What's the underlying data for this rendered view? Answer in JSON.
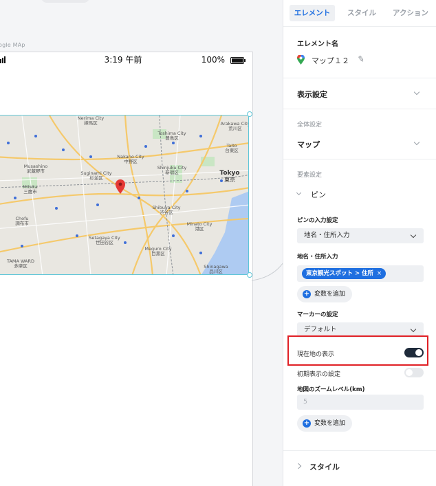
{
  "canvas": {
    "frame_label": "ogle MAp",
    "status_bar": {
      "time": "3:19 午前",
      "battery_text": "100%"
    },
    "map_labels": [
      {
        "text": "Nerima City"
      },
      {
        "text": "練馬区"
      },
      {
        "text": "Toshima City"
      },
      {
        "text": "豊島区"
      },
      {
        "text": "Arakawa City"
      },
      {
        "text": "荒川区"
      },
      {
        "text": "Nakano City"
      },
      {
        "text": "中野区"
      },
      {
        "text": "Suginami City"
      },
      {
        "text": "杉並区"
      },
      {
        "text": "Shinjuku City"
      },
      {
        "text": "新宿区"
      },
      {
        "text": "Tokyo"
      },
      {
        "text": "東京"
      },
      {
        "text": "Shibuya City"
      },
      {
        "text": "渋谷区"
      },
      {
        "text": "Minato City"
      },
      {
        "text": "港区"
      },
      {
        "text": "Setagaya City"
      },
      {
        "text": "世田谷区"
      },
      {
        "text": "Meguro City"
      },
      {
        "text": "目黒区"
      },
      {
        "text": "Shinagawa"
      },
      {
        "text": "品川区"
      },
      {
        "text": "Mitaka"
      },
      {
        "text": "三鷹市"
      },
      {
        "text": "Chofu"
      },
      {
        "text": "調布市"
      },
      {
        "text": "Musashino"
      },
      {
        "text": "武蔵野市"
      },
      {
        "text": "Taito"
      },
      {
        "text": "台東区"
      },
      {
        "text": "TAMA WARD"
      },
      {
        "text": "多摩区"
      }
    ]
  },
  "panel": {
    "tabs": [
      {
        "label": "エレメント",
        "active": true
      },
      {
        "label": "スタイル",
        "active": false
      },
      {
        "label": "アクション",
        "active": false
      }
    ],
    "element_name_heading": "エレメント名",
    "element_name": "マップ１２",
    "display_settings": "表示設定",
    "global_settings_label": "全体設定",
    "global_settings_value": "マップ",
    "element_settings_label": "要素設定",
    "pin_section": "ピン",
    "pin_input_label": "ピンの入力設定",
    "pin_input_value": "地名・住所入力",
    "address_input_label": "地名・住所入力",
    "address_chip": "東京観光スポット > 住所",
    "add_variable_label": "変数を追加",
    "marker_label": "マーカーの設定",
    "marker_value": "デフォルト",
    "current_location_label": "現在地の表示",
    "current_location_enabled": true,
    "initial_display_label": "初期表示の設定",
    "initial_display_enabled": false,
    "zoom_label": "地図のズームレベル(km)",
    "zoom_placeholder": "5",
    "add_variable_label_2": "変数を追加",
    "style_section": "スタイル"
  },
  "colors": {
    "accent": "#1f6fe0",
    "highlight": "#e01f25",
    "toggle_on": "#1e2a3a",
    "toggle_off": "#e6e8eb"
  }
}
